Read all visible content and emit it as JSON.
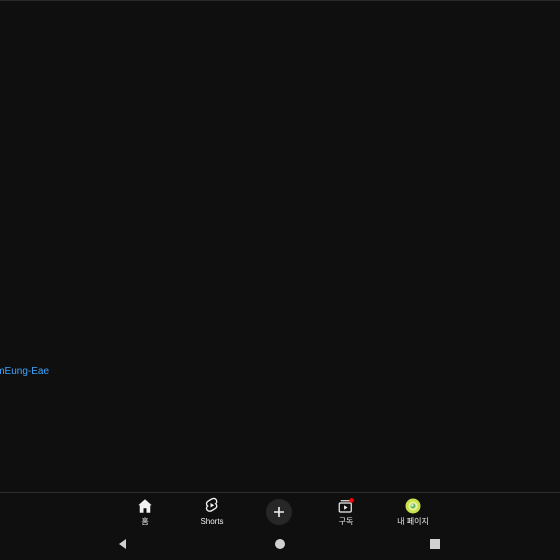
{
  "content": {
    "channel_link": "imEung-Eae"
  },
  "bottom_nav": {
    "items": [
      {
        "label": "홈",
        "icon": "home-icon"
      },
      {
        "label": "Shorts",
        "icon": "shorts-icon"
      },
      {
        "label": "",
        "icon": "plus-icon"
      },
      {
        "label": "구독",
        "icon": "subscriptions-icon"
      },
      {
        "label": "내 페이지",
        "icon": "avatar-icon"
      }
    ]
  },
  "system_nav": {
    "icons": [
      "back-icon",
      "home-circle-icon",
      "recents-icon"
    ]
  },
  "colors": {
    "background": "#0f0f0f",
    "link": "#3ea6ff",
    "notification": "#ff0000",
    "avatar": "#c8e34a"
  }
}
